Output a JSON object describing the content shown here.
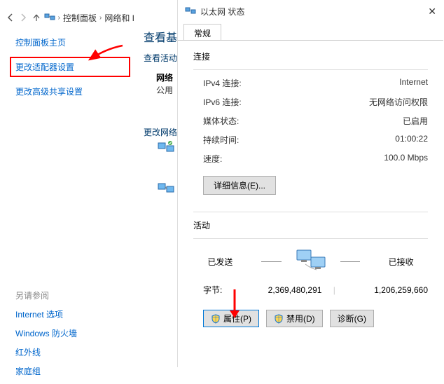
{
  "breadcrumb": {
    "item1": "控制面板",
    "item2": "网络和 I"
  },
  "sidebar": {
    "home": "控制面板主页",
    "adapter_settings": "更改适配器设置",
    "sharing_settings": "更改高级共享设置"
  },
  "middle": {
    "view_basic": "查看基",
    "view_active": "查看活动",
    "net_title": "网络",
    "net_type": "公用",
    "change_net": "更改网络"
  },
  "also_see": {
    "title": "另请参阅",
    "internet_options": "Internet 选项",
    "firewall": "Windows 防火墙",
    "infrared": "红外线",
    "homegroup": "家庭组"
  },
  "dialog": {
    "title": "以太网 状态",
    "tab_general": "常规",
    "connection_section": "连接",
    "ipv4_label": "IPv4 连接:",
    "ipv4_value": "Internet",
    "ipv6_label": "IPv6 连接:",
    "ipv6_value": "无网络访问权限",
    "media_label": "媒体状态:",
    "media_value": "已启用",
    "duration_label": "持续时间:",
    "duration_value": "01:00:22",
    "speed_label": "速度:",
    "speed_value": "100.0 Mbps",
    "details_btn": "详细信息(E)...",
    "activity_section": "活动",
    "sent_label": "已发送",
    "received_label": "已接收",
    "bytes_label": "字节:",
    "bytes_sent": "2,369,480,291",
    "bytes_recv": "1,206,259,660",
    "properties_btn": "属性(P)",
    "disable_btn": "禁用(D)",
    "diagnose_btn": "诊断(G)"
  },
  "icons": {
    "shield": "shield-icon",
    "monitors": "monitors-icon"
  }
}
